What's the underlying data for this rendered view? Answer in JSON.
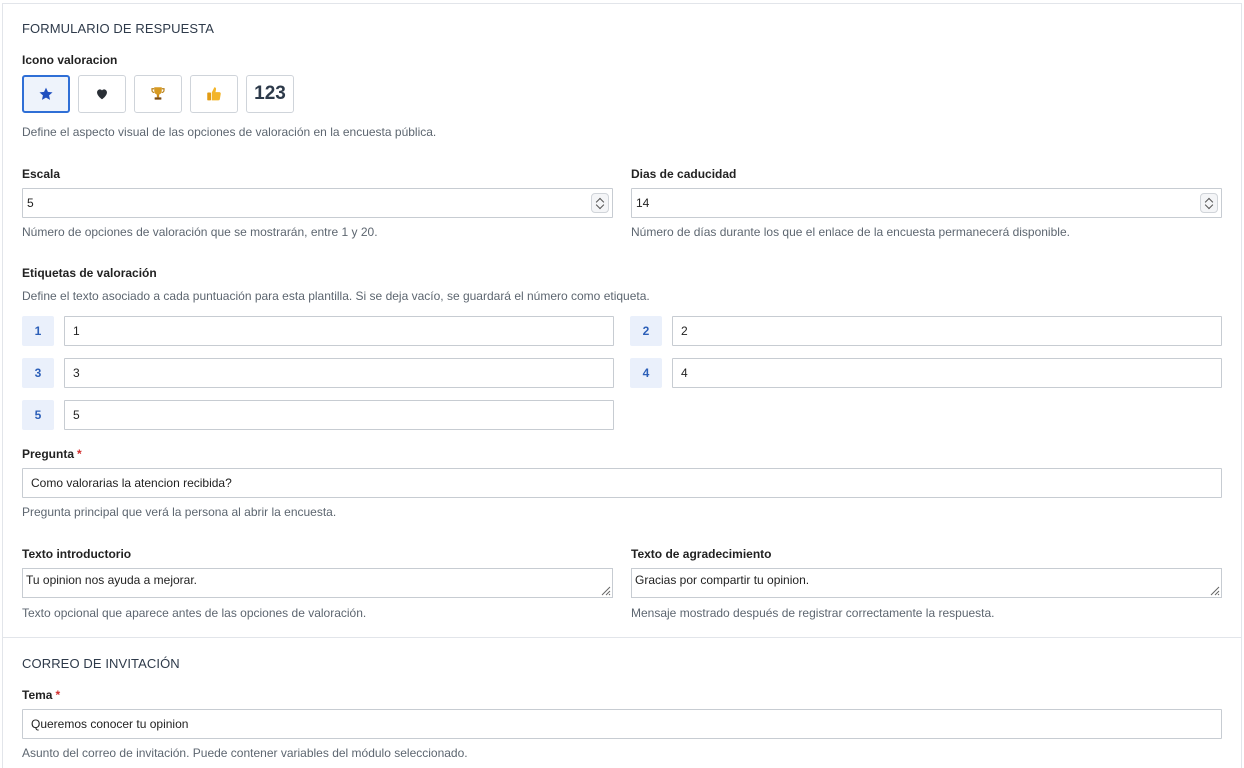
{
  "response_form": {
    "section_title": "FORMULARIO DE RESPUESTA",
    "icon_rating": {
      "label": "Icono valoracion",
      "options": [
        {
          "icon": "star-icon",
          "selected": true
        },
        {
          "icon": "heart-icon",
          "selected": false
        },
        {
          "icon": "trophy-icon",
          "selected": false
        },
        {
          "icon": "thumbs-up-icon",
          "selected": false
        },
        {
          "icon": "numeric-icon",
          "text": "123",
          "selected": false
        }
      ],
      "help": "Define el aspecto visual de las opciones de valoración en la encuesta pública."
    },
    "scale": {
      "label": "Escala",
      "value": "5",
      "help": "Número de opciones de valoración que se mostrarán, entre 1 y 20."
    },
    "expiry_days": {
      "label": "Dias de caducidad",
      "value": "14",
      "help": "Número de días durante los que el enlace de la encuesta permanecerá disponible."
    },
    "rating_labels": {
      "label": "Etiquetas de valoración",
      "help": "Define el texto asociado a cada puntuación para esta plantilla. Si se deja vacío, se guardará el número como etiqueta.",
      "items": [
        {
          "index": "1",
          "value": "1"
        },
        {
          "index": "2",
          "value": "2"
        },
        {
          "index": "3",
          "value": "3"
        },
        {
          "index": "4",
          "value": "4"
        },
        {
          "index": "5",
          "value": "5"
        }
      ]
    },
    "question": {
      "label": "Pregunta",
      "required_mark": "*",
      "value": "Como valorarias la atencion recibida?",
      "help": "Pregunta principal que verá la persona al abrir la encuesta."
    },
    "intro_text": {
      "label": "Texto introductorio",
      "value": "Tu opinion nos ayuda a mejorar.",
      "help": "Texto opcional que aparece antes de las opciones de valoración."
    },
    "thanks_text": {
      "label": "Texto de agradecimiento",
      "value": "Gracias por compartir tu opinion.",
      "help": "Mensaje mostrado después de registrar correctamente la respuesta."
    }
  },
  "invitation_email": {
    "section_title": "CORREO DE INVITACIÓN",
    "subject": {
      "label": "Tema",
      "required_mark": "*",
      "value": "Queremos conocer tu opinion",
      "help": "Asunto del correo de invitación. Puede contener variables del módulo seleccionado."
    }
  },
  "colors": {
    "accent": "#2f6fd6",
    "badge_bg": "#eaf0fb",
    "badge_text": "#2c5fb8",
    "required": "#d12c2c",
    "star": "#1f4fbf",
    "trophy": "#c98a1a",
    "thumb": "#f3b52a"
  }
}
